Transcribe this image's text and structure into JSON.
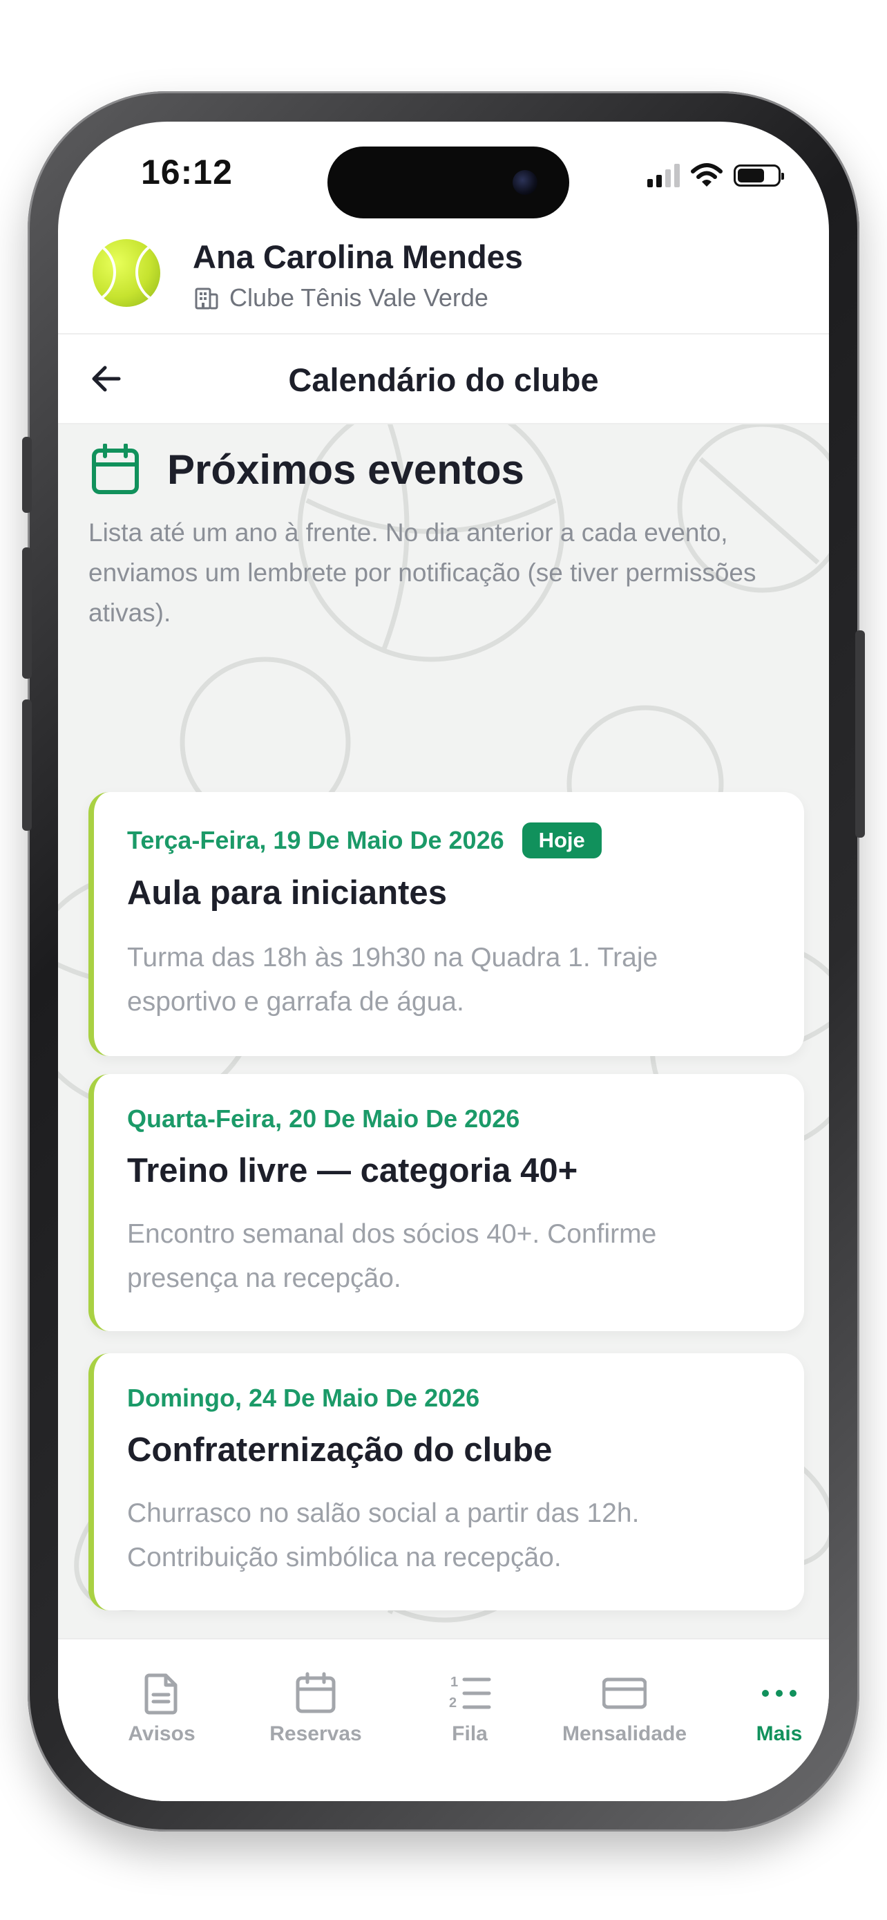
{
  "status_bar": {
    "time": "16:12"
  },
  "profile": {
    "name": "Ana Carolina Mendes",
    "club": "Clube Tênis Vale Verde",
    "avatar_icon": "tennis-ball-icon",
    "club_icon": "building-icon"
  },
  "nav": {
    "title": "Calendário do clube",
    "back_icon": "arrow-left-icon"
  },
  "section": {
    "title": "Próximos eventos",
    "icon": "calendar-icon",
    "description": "Lista até um ano à frente. No dia anterior a cada evento, enviamos um lembrete por notificação (se tiver permissões ativas)."
  },
  "events": [
    {
      "date": "Terça-Feira, 19 De Maio De 2026",
      "badge": "Hoje",
      "title": "Aula para iniciantes",
      "desc_line1": "Turma das 18h às 19h30 na Quadra 1. Traje",
      "desc_line2": "esportivo e garrafa de água."
    },
    {
      "date": "Quarta-Feira, 20 De Maio De 2026",
      "title": "Treino livre — categoria 40+",
      "desc_line1": "Encontro semanal dos sócios 40+. Confirme",
      "desc_line2": "presença na recepção."
    },
    {
      "date": "Domingo, 24 De Maio De 2026",
      "title": "Confraternização do clube",
      "desc_line1": "Churrasco no salão social a partir das 12h.",
      "desc_line2": "Contribuição simbólica na recepção."
    }
  ],
  "tabs": [
    {
      "label": "Avisos",
      "icon": "document-icon"
    },
    {
      "label": "Reservas",
      "icon": "calendar-icon"
    },
    {
      "label": "Fila",
      "icon": "numbered-list-icon"
    },
    {
      "label": "Mensalidade",
      "icon": "credit-card-icon"
    },
    {
      "label": "Mais",
      "icon": "more-dots-icon",
      "active": true
    }
  ],
  "colors": {
    "accent_green": "#11915c",
    "date_green": "#1b9a68",
    "card_stripe": "#a9d143",
    "text_dark": "#1d1f2a",
    "text_muted": "#9da1a8"
  }
}
